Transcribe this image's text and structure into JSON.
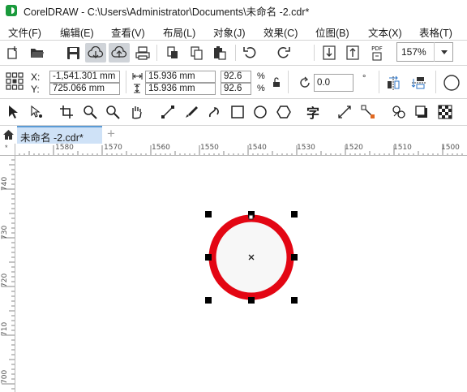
{
  "window": {
    "title": "CorelDRAW - C:\\Users\\Administrator\\Documents\\未命名 -2.cdr*"
  },
  "menu": [
    {
      "label": "文件(F)"
    },
    {
      "label": "编辑(E)"
    },
    {
      "label": "查看(V)"
    },
    {
      "label": "布局(L)"
    },
    {
      "label": "对象(J)"
    },
    {
      "label": "效果(C)"
    },
    {
      "label": "位图(B)"
    },
    {
      "label": "文本(X)"
    },
    {
      "label": "表格(T)"
    }
  ],
  "standard_toolbar": {
    "zoom": "157%",
    "pdf_label": "PDF"
  },
  "property_bar": {
    "x_label": "X:",
    "y_label": "Y:",
    "x_value": "-1,541.301 mm",
    "y_value": "725.066 mm",
    "width_value": "15.936 mm",
    "height_value": "15.936 mm",
    "scale_x": "92.6",
    "scale_y": "92.6",
    "percent": "%",
    "rotation": "0.0",
    "degree": "°"
  },
  "toolbox": {
    "text_tool": "字"
  },
  "tabs": {
    "document_tab": "未命名 -2.cdr*",
    "add": "+"
  },
  "rulers": {
    "horizontal": [
      "1580",
      "1570",
      "1560",
      "1550",
      "1540",
      "1530",
      "1520",
      "1510",
      "1500"
    ],
    "vertical": [
      "740",
      "730",
      "720",
      "710",
      "700"
    ],
    "corner": "*"
  },
  "colors": {
    "ring": "#e30613",
    "ring_inner": "#f7f7f7",
    "tab_active": "#cfe2f7",
    "logo": "#1a9a3c"
  }
}
